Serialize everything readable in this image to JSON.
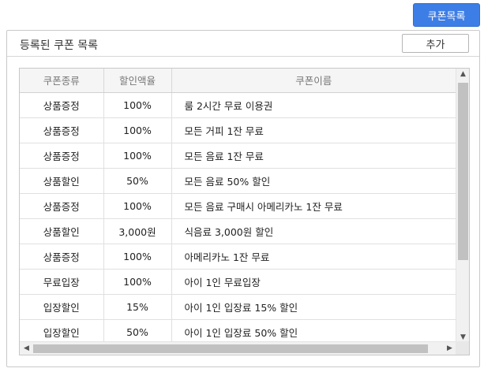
{
  "top_button": {
    "label": "쿠폰목록"
  },
  "panel": {
    "title": "등록된 쿠폰 목록",
    "add_label": "추가"
  },
  "table": {
    "headers": [
      "쿠폰종류",
      "할인액율",
      "쿠폰이름"
    ],
    "rows": [
      [
        "상품증정",
        "100%",
        "룸 2시간 무료 이용권"
      ],
      [
        "상품증정",
        "100%",
        "모든 거피 1잔 무료"
      ],
      [
        "상품증정",
        "100%",
        "모든 음료 1잔 무료"
      ],
      [
        "상품할인",
        "50%",
        "모든 음료 50% 할인"
      ],
      [
        "상품증정",
        "100%",
        "모든 음료 구매시 아메리카노 1잔 무료"
      ],
      [
        "상품할인",
        "3,000원",
        "식음료 3,000원 할인"
      ],
      [
        "상품증정",
        "100%",
        "아메리카노 1잔 무료"
      ],
      [
        "무료입장",
        "100%",
        "아이 1인 무료입장"
      ],
      [
        "입장할인",
        "15%",
        "아이 1인 입장료 15% 할인"
      ],
      [
        "입장할인",
        "50%",
        "아이 1인 입장료 50% 할인"
      ]
    ]
  },
  "scrollbars": {
    "up": "▲",
    "down": "▼",
    "left": "◀",
    "right": "▶"
  }
}
